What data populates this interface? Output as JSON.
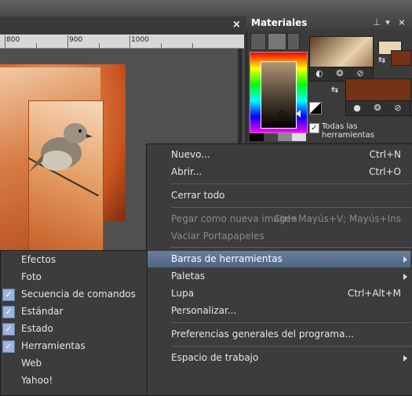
{
  "document": {
    "close_label": "×"
  },
  "ruler": {
    "labels": [
      "800",
      "900",
      "1000"
    ]
  },
  "materials": {
    "title": "Materiales",
    "pin_icon": "pin-icon",
    "close_label": "×",
    "all_tools_label": "Todas las herramientas",
    "all_tools_checked": true,
    "colors": {
      "foreground": "#e9d8b6",
      "background": "#743216"
    }
  },
  "menu": {
    "items": [
      {
        "label": "Nuevo...",
        "shortcut": "Ctrl+N"
      },
      {
        "label": "Abrir...",
        "shortcut": "Ctrl+O"
      },
      {
        "label": "Cerrar todo",
        "shortcut": ""
      },
      {
        "label": "Pegar como nueva imagen",
        "shortcut": "Ctrl+Mayús+V; Mayús+Ins"
      },
      {
        "label": "Vaciar Portapapeles",
        "shortcut": ""
      },
      {
        "label": "Barras de herramientas",
        "shortcut": ""
      },
      {
        "label": "Paletas",
        "shortcut": ""
      },
      {
        "label": "Lupa",
        "shortcut": "Ctrl+Alt+M"
      },
      {
        "label": "Personalizar...",
        "shortcut": ""
      },
      {
        "label": "Preferencias generales del programa...",
        "shortcut": ""
      },
      {
        "label": "Espacio de trabajo",
        "shortcut": ""
      }
    ]
  },
  "submenu": {
    "items": [
      {
        "label": "Efectos",
        "checked": false
      },
      {
        "label": "Foto",
        "checked": false
      },
      {
        "label": "Secuencia de comandos",
        "checked": true
      },
      {
        "label": "Estándar",
        "checked": true
      },
      {
        "label": "Estado",
        "checked": true
      },
      {
        "label": "Herramientas",
        "checked": true
      },
      {
        "label": "Web",
        "checked": false
      },
      {
        "label": "Yahoo!",
        "checked": false
      }
    ]
  },
  "accent_color": "#5a7092"
}
